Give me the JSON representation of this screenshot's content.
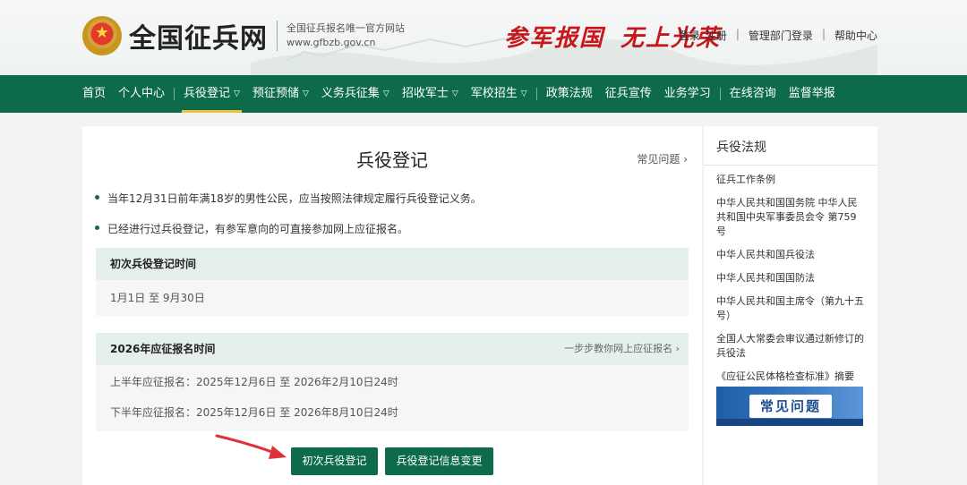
{
  "header": {
    "site_name": "全国征兵网",
    "subtitle_line1": "全国征兵报名唯一官方网站",
    "subtitle_line2": "www.gfbzb.gov.cn",
    "slogan1": "参军报国",
    "slogan2": "无上光荣",
    "links": [
      "登录",
      "注册",
      "管理部门登录",
      "帮助中心"
    ]
  },
  "nav": {
    "items": [
      {
        "label": "首页"
      },
      {
        "label": "个人中心"
      },
      {
        "label": "兵役登记"
      },
      {
        "label": "预征预储"
      },
      {
        "label": "义务兵征集"
      },
      {
        "label": "招收军士"
      },
      {
        "label": "军校招生"
      },
      {
        "label": "政策法规"
      },
      {
        "label": "征兵宣传"
      },
      {
        "label": "业务学习"
      },
      {
        "label": "在线咨询"
      },
      {
        "label": "监督举报"
      }
    ]
  },
  "main": {
    "title": "兵役登记",
    "faq_link": "常见问题",
    "bullets": [
      "当年12月31日前年满18岁的男性公民，应当按照法律规定履行兵役登记义务。",
      "已经进行过兵役登记，有参军意向的可直接参加网上应征报名。"
    ],
    "box1": {
      "header": "初次兵役登记时间",
      "row": "1月1日 至 9月30日"
    },
    "box2": {
      "header": "2026年应征报名时间",
      "link": "一步步教你网上应征报名",
      "row1": "上半年应征报名：2025年12月6日 至 2026年2月10日24时",
      "row2": "下半年应征报名：2025年12月6日 至 2026年8月10日24时"
    },
    "btn_first": "初次兵役登记",
    "btn_change": "兵役登记信息变更"
  },
  "sidebar": {
    "title": "兵役法规",
    "items": [
      "征兵工作条例",
      "中华人民共和国国务院 中华人民共和国中央军事委员会令 第759号",
      "中华人民共和国兵役法",
      "中华人民共和国国防法",
      "中华人民共和国主席令（第九十五号）",
      "全国人大常委会审议通过新修订的兵役法",
      "《应征公民体格检查标准》摘要"
    ],
    "banner": "常见问题"
  },
  "colors": {
    "brand_green": "#0e6b4a",
    "accent_red": "#c8161d",
    "annotation_red": "#e0303a"
  }
}
